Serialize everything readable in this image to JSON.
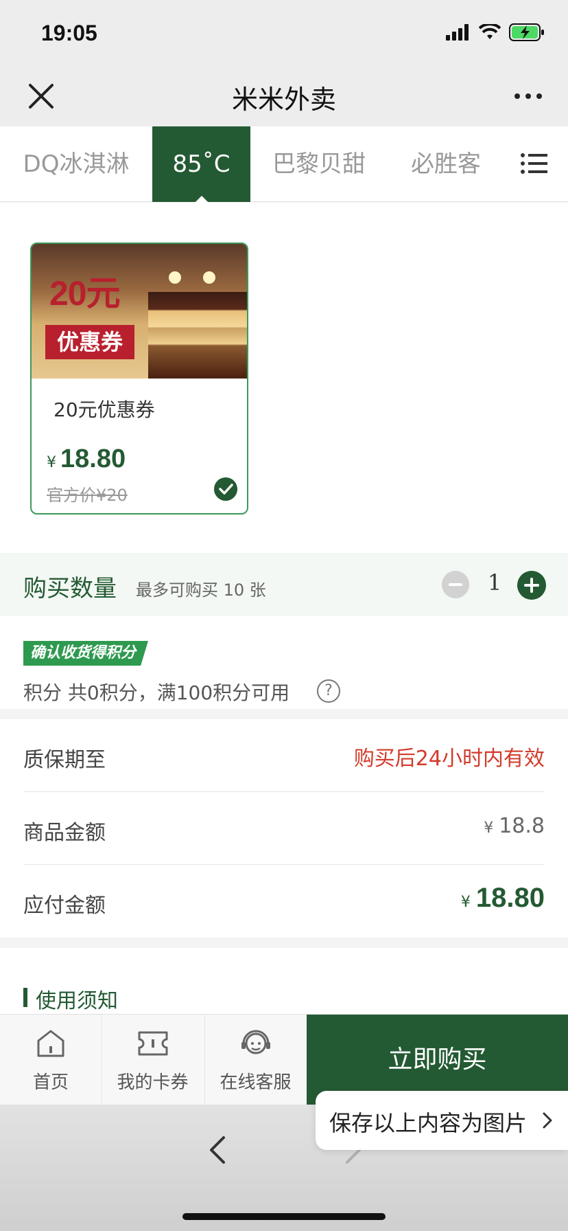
{
  "status": {
    "time": "19:05"
  },
  "nav": {
    "title": "米米外卖"
  },
  "tabs": [
    {
      "label": "DQ冰淇淋",
      "active": false
    },
    {
      "label": "85˚C",
      "active": true
    },
    {
      "label": "巴黎贝甜",
      "active": false
    },
    {
      "label": "必胜客",
      "active": false
    }
  ],
  "product": {
    "image_amount": "20元",
    "image_tag": "优惠券",
    "name": "20元优惠券",
    "currency": "¥",
    "price": "18.80",
    "original_price": "官方价¥20",
    "selected": true
  },
  "quantity": {
    "label": "购买数量",
    "hint": "最多可购买 10 张",
    "value": "1"
  },
  "points": {
    "badge": "确认收货得积分",
    "text": "积分   共0积分，满100积分可用",
    "help_icon": "?"
  },
  "info": {
    "warranty_label": "质保期至",
    "warranty_value": "购买后24小时内有效",
    "goods_label": "商品金额",
    "goods_currency": "¥",
    "goods_value": "18.8",
    "pay_label": "应付金额",
    "pay_currency": "¥",
    "pay_value": "18.80"
  },
  "notice": {
    "title": "使用须知"
  },
  "bottom_bar": {
    "home": "首页",
    "cards": "我的卡券",
    "service": "在线客服",
    "buy": "立即购买"
  },
  "popup": {
    "save_label": "保存以上内容为图片"
  },
  "colors": {
    "brand_green": "#245a33",
    "warning_red": "#d33a2c",
    "badge_green": "#2e9a50",
    "coupon_red": "#b8202e"
  }
}
